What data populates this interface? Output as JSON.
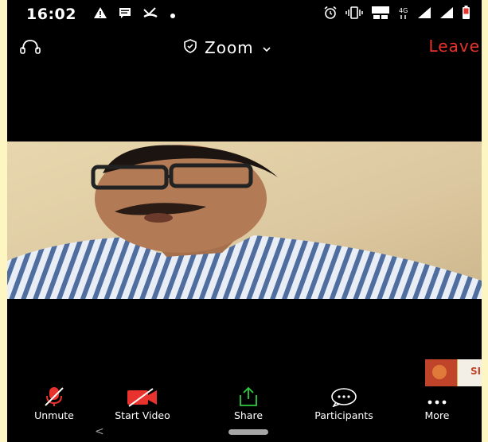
{
  "status_bar": {
    "time": "16:02",
    "left_icons": [
      "warning-icon",
      "message-icon",
      "missed-call-icon",
      "dot-icon"
    ],
    "right_icons": [
      "alarm-icon",
      "vibrate-icon",
      "volte-icon",
      "4g-icon",
      "signal-icon",
      "signal-icon",
      "battery-icon"
    ]
  },
  "top_bar": {
    "title": "Zoom",
    "leave_label": "Leave",
    "leave_color": "#e8322d"
  },
  "video": {
    "description_icon": "participant-video-feed"
  },
  "thumbnail": {
    "label": "SI"
  },
  "toolbar": {
    "items": [
      {
        "label": "Unmute",
        "icon": "muted-microphone-icon",
        "color": "#e8322d"
      },
      {
        "label": "Start Video",
        "icon": "video-off-icon",
        "color": "#e8322d"
      },
      {
        "label": "Share",
        "icon": "share-icon",
        "color": "#2ecc40"
      },
      {
        "label": "Participants",
        "icon": "chat-bubble-icon",
        "color": "#ffffff"
      },
      {
        "label": "More",
        "icon": "more-dots-icon",
        "color": "#ffffff"
      }
    ]
  },
  "nav_bar": {
    "back_glyph": "<"
  },
  "colors": {
    "frame": "#fdf6c3",
    "background": "#000000",
    "accent_red": "#e8322d",
    "share_green": "#2ecc40"
  }
}
